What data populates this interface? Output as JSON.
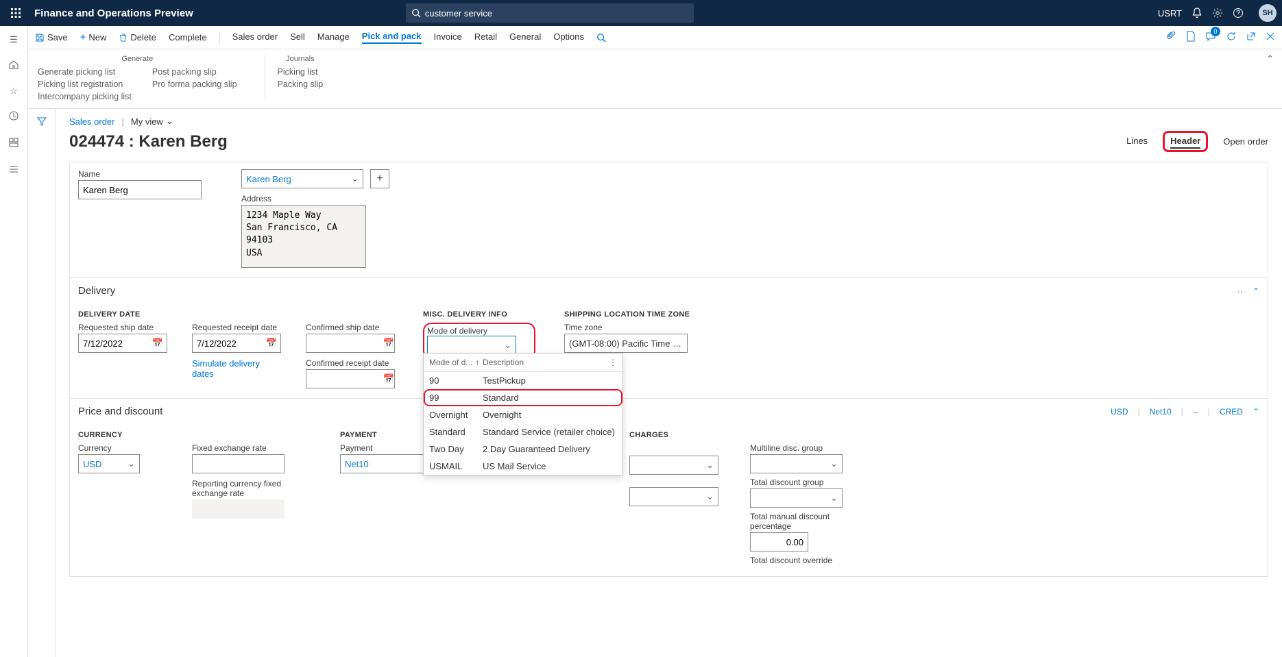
{
  "top": {
    "title": "Finance and Operations Preview",
    "search": "customer service",
    "user": "USRT",
    "avatar": "SH"
  },
  "action_bar": {
    "save": "Save",
    "new": "New",
    "delete": "Delete",
    "complete": "Complete",
    "tabs": [
      "Sales order",
      "Sell",
      "Manage",
      "Pick and pack",
      "Invoice",
      "Retail",
      "General",
      "Options"
    ],
    "active_tab": "Pick and pack",
    "badge": "0"
  },
  "sub": {
    "generate": {
      "head": "Generate",
      "col1": [
        "Generate picking list",
        "Picking list registration",
        "Intercompany picking list"
      ],
      "col2": [
        "Post packing slip",
        "Pro forma packing slip"
      ]
    },
    "journals": {
      "head": "Journals",
      "col1": [
        "Picking list",
        "Packing slip"
      ]
    }
  },
  "bc": {
    "link": "Sales order",
    "view": "My view"
  },
  "page_title": "024474 : Karen Berg",
  "view_tabs": {
    "lines": "Lines",
    "header": "Header",
    "status": "Open order"
  },
  "name_section": {
    "name_label": "Name",
    "name_value": "Karen Berg",
    "dd_value": "Karen Berg",
    "address_label": "Address",
    "address_value": "1234 Maple Way\nSan Francisco, CA 94103\nUSA"
  },
  "delivery": {
    "head": "Delivery",
    "date_hdr": "DELIVERY DATE",
    "req_ship_label": "Requested ship date",
    "req_ship_value": "7/12/2022",
    "req_rcpt_label": "Requested receipt date",
    "req_rcpt_value": "7/12/2022",
    "sim_link": "Simulate delivery dates",
    "conf_ship_label": "Confirmed ship date",
    "conf_rcpt_label": "Confirmed receipt date",
    "misc_hdr": "MISC. DELIVERY INFO",
    "mode_label": "Mode of delivery",
    "ship_hdr": "SHIPPING LOCATION TIME ZONE",
    "tz_label": "Time zone",
    "tz_value": "(GMT-08:00) Pacific Time (US & ...",
    "dd": {
      "col1": "Mode of d...",
      "col2": "Description",
      "rows": [
        {
          "c": "90",
          "d": "TestPickup"
        },
        {
          "c": "99",
          "d": "Standard"
        },
        {
          "c": "Overnight",
          "d": "Overnight"
        },
        {
          "c": "Standard",
          "d": "Standard Service (retailer choice)"
        },
        {
          "c": "Two Day",
          "d": "2 Day Guaranteed Delivery"
        },
        {
          "c": "USMAIL",
          "d": "US Mail Service"
        }
      ]
    }
  },
  "price": {
    "head": "Price and discount",
    "tags": [
      "USD",
      "Net10",
      "--",
      "CRED"
    ],
    "currency_hdr": "CURRENCY",
    "currency_label": "Currency",
    "currency_value": "USD",
    "fx_label": "Fixed exchange rate",
    "rep_fx_label": "Reporting currency fixed exchange rate",
    "payment_hdr": "PAYMENT",
    "payment_label": "Payment",
    "payment_value": "Net10",
    "charges_hdr": "CHARGES",
    "ml_label": "Multiline disc. group",
    "td_label": "Total discount group",
    "tmd_label": "Total manual discount percentage",
    "tmd_value": "0.00",
    "tdo_label": "Total discount override"
  }
}
